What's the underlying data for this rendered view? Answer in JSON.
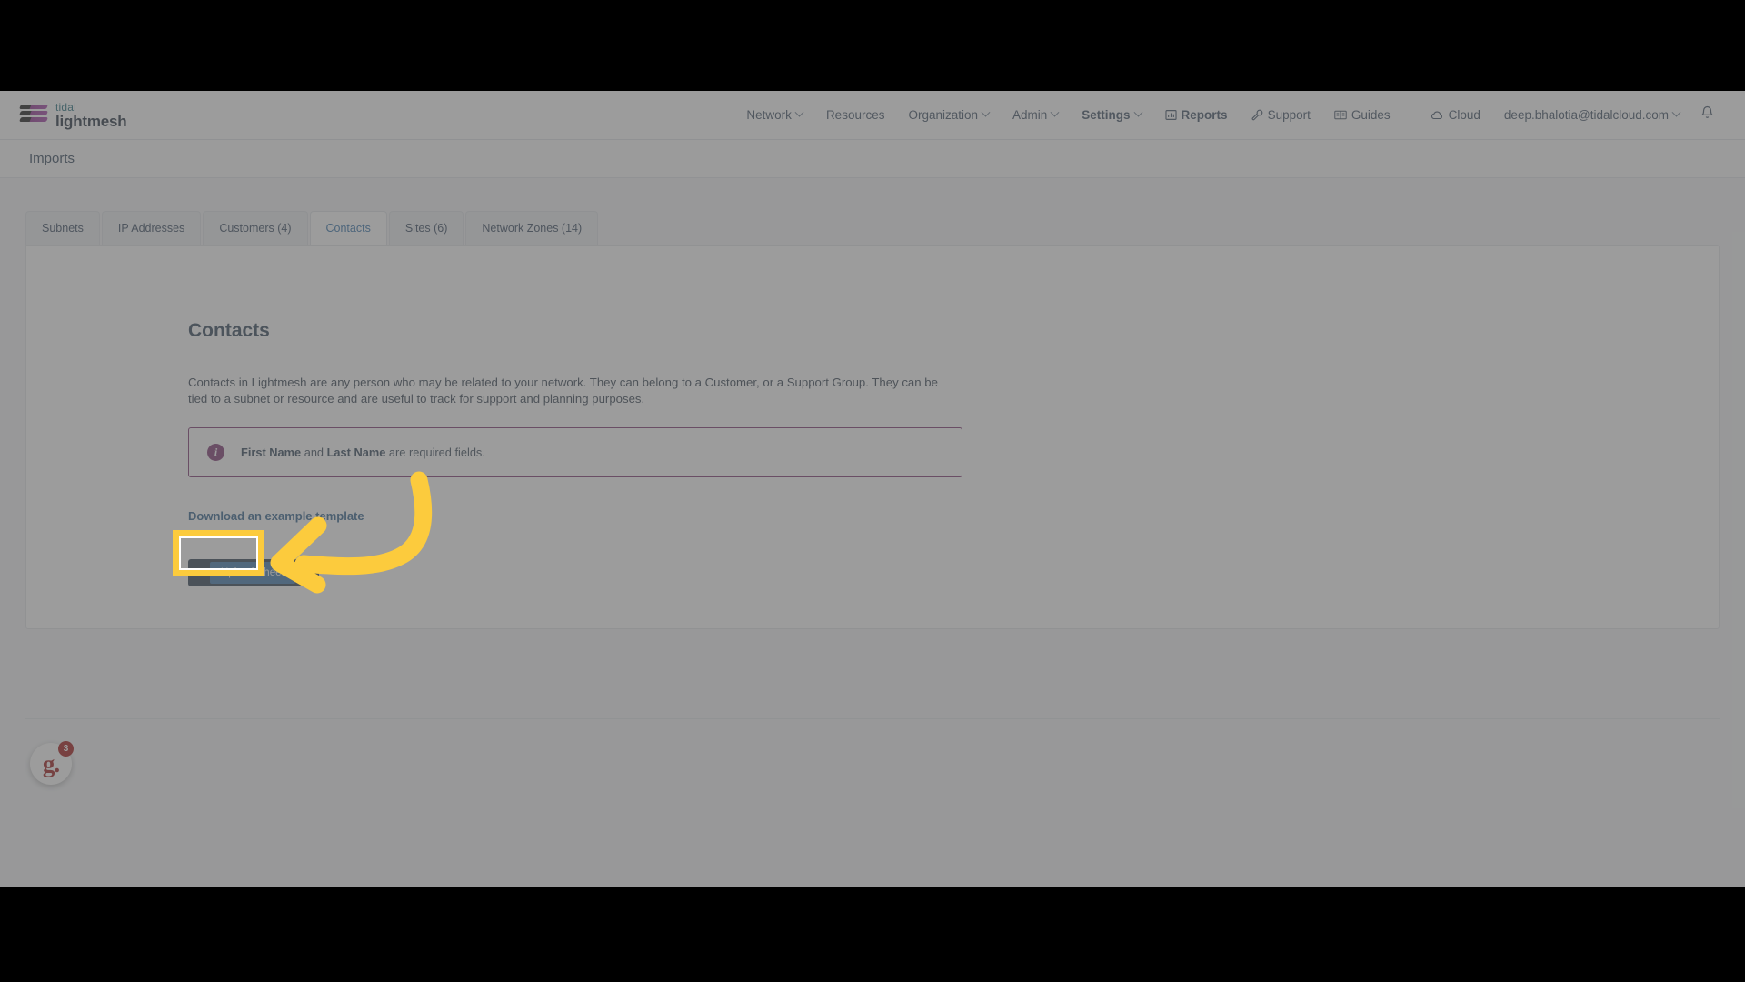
{
  "topnav": {
    "brand": {
      "line1": "tidal",
      "line2": "lightmesh",
      "logo_icon": "tidal-lightmesh-logo"
    },
    "items": [
      {
        "label": "Network",
        "has_caret": true,
        "icon": null
      },
      {
        "label": "Resources",
        "has_caret": false,
        "icon": null
      },
      {
        "label": "Organization",
        "has_caret": true,
        "icon": null
      },
      {
        "label": "Admin",
        "has_caret": true,
        "icon": null
      },
      {
        "label": "Settings",
        "has_caret": true,
        "icon": null,
        "bold": true
      },
      {
        "label": "Reports",
        "has_caret": false,
        "icon": "bar-chart-icon"
      },
      {
        "label": "Support",
        "has_caret": false,
        "icon": "wrench-icon"
      },
      {
        "label": "Guides",
        "has_caret": false,
        "icon": "book-icon"
      },
      {
        "label": "Cloud",
        "has_caret": false,
        "icon": "cloud-icon"
      }
    ],
    "user_email": "deep.bhalotia@tidalcloud.com",
    "notifications_icon": "bell-icon"
  },
  "page_header": {
    "title": "Imports"
  },
  "tabs": [
    {
      "label": "Subnets",
      "active": false
    },
    {
      "label": "IP Addresses",
      "active": false
    },
    {
      "label": "Customers (4)",
      "active": false
    },
    {
      "label": "Contacts",
      "active": true
    },
    {
      "label": "Sites (6)",
      "active": false
    },
    {
      "label": "Network Zones (14)",
      "active": false
    }
  ],
  "content": {
    "heading": "Contacts",
    "description": "Contacts in Lightmesh are any person who may be related to your network. They can belong to a Customer, or a Support Group. They can be tied to a subnet or resource and are useful to track for support and planning purposes.",
    "alert": {
      "icon": "info-icon",
      "icon_glyph": "i",
      "bold_1": "First Name",
      "middle": " and ",
      "bold_2": "Last Name",
      "tail": " are required fields.",
      "border_color": "#7b3370"
    },
    "download_link": "Download an example template",
    "upload_button": "Upload Sheet",
    "upload_icon": "upload-icon"
  },
  "annotation": {
    "highlight_color": "#fccb3d",
    "arrow_color": "#fccb3d",
    "arrow_icon": "curved-left-arrow"
  },
  "support_widget": {
    "logo_text": "g.",
    "badge_count": "3",
    "accent_color": "#a11010"
  }
}
